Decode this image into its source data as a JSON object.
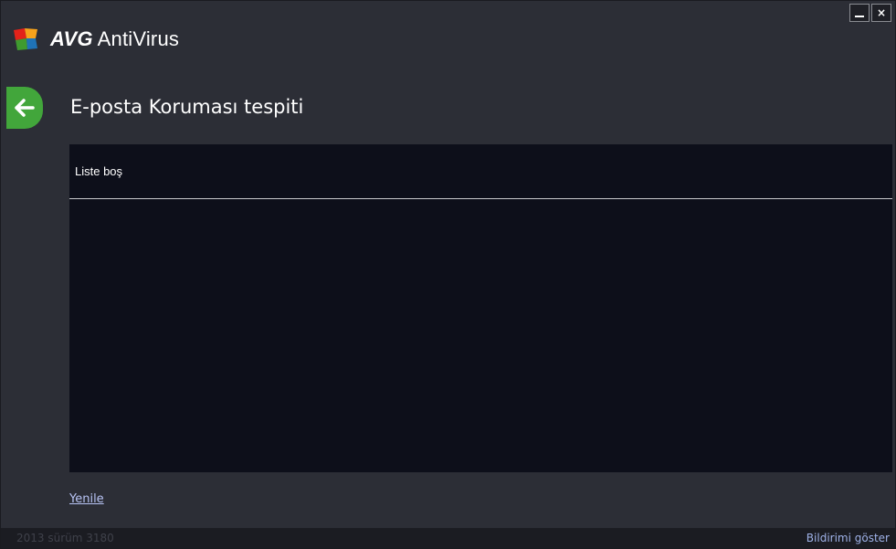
{
  "window": {
    "minimize_label": "_",
    "close_label": "×"
  },
  "brand": {
    "bold": "AVG",
    "product": "AntiVirus",
    "logo_colors": [
      "#e32219",
      "#f7a21b",
      "#3f9b2f",
      "#1f73b7"
    ]
  },
  "header": {
    "back_icon": "arrow-left-icon",
    "title": "E-posta Koruması tespiti"
  },
  "list": {
    "empty_text": "Liste boş"
  },
  "actions": {
    "refresh_label": "Yenile"
  },
  "status_bar": {
    "version_text": "2013  sürüm 3180",
    "notify_label": "Bildirimi göster"
  },
  "colors": {
    "background": "#2c2e36",
    "panel": "#0d0f1a",
    "accent_green": "#42a63b",
    "link": "#b8c4f5"
  }
}
